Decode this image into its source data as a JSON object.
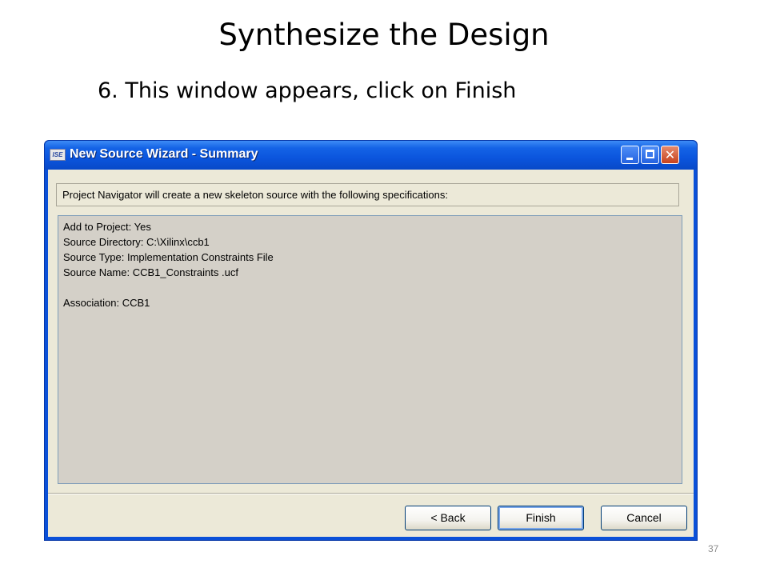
{
  "slide": {
    "title": "Synthesize the Design",
    "subtitle": "6. This window appears, click on Finish",
    "page_number": "37"
  },
  "window": {
    "title": "New Source Wizard - Summary",
    "app_icon_text": "ISE",
    "controls": {
      "minimize": "minimize-icon",
      "maximize": "maximize-icon",
      "close": "close-icon",
      "close_glyph": "✕"
    }
  },
  "dialog": {
    "spec_text": "Project Navigator will create a new skeleton source with the following specifications:",
    "summary_lines": [
      "Add to Project: Yes",
      "Source Directory: C:\\Xilinx\\ccb1",
      "Source Type: Implementation Constraints File",
      "Source Name: CCB1_Constraints .ucf",
      "",
      "Association: CCB1"
    ],
    "buttons": {
      "back": "< Back",
      "finish": "Finish",
      "cancel": "Cancel"
    }
  },
  "colors": {
    "titlebar": "#0a50d8",
    "dialog_bg": "#ece9d8",
    "summary_bg": "#d4d0c8"
  }
}
